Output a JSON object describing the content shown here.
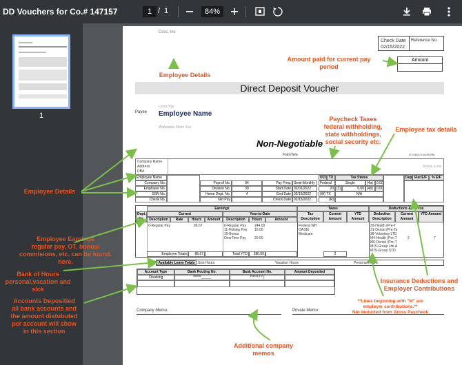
{
  "viewer": {
    "title": "DD Vouchers for Co.# 147157",
    "current_page": "1",
    "page_sep": "/",
    "total_pages": "1",
    "zoom": "84%",
    "thumb_number": "1"
  },
  "voucher": {
    "company_blur": "Cccc, Inc",
    "check_date_label": "Check Date",
    "check_date": "02/15/2022",
    "reference_label": "Reference No.",
    "amount_label": "Amount",
    "heading": "Direct Deposit Voucher",
    "payee_label": "Payee",
    "payee_blur_top": "Lxxxx Yyy",
    "employee_name": "Employee Name",
    "payee_blur_bottom": "Wwwwww, Nnnn Xxx",
    "non_negotiable": "Non-Negotiable",
    "fold_here": "Fold Here",
    "print_stamp": "2/7/2022 5:16:00 PM",
    "company_blur_right": "Xxxxx, x xxx",
    "info_left": [
      [
        "Company Name",
        ""
      ],
      [
        "Address",
        ""
      ],
      [
        "DBA",
        ""
      ]
    ],
    "employee_rows": [
      [
        "Employee Name",
        "",
        "",
        "",
        "",
        ""
      ],
      [
        "Company No.",
        "",
        "Payroll No.",
        "94",
        "Pay Freq.",
        "Semi-Monthly"
      ],
      [
        "Employee No.",
        "",
        "Division No.",
        "39",
        "Start Date",
        "02/01/2022"
      ],
      [
        "SSN No.",
        "",
        "Home Dept. No.",
        "4",
        "End Date",
        "02/15/2022"
      ],
      [
        "Check No.",
        "",
        "Net Pay",
        "",
        "Check Date",
        "02/15/2022"
      ]
    ],
    "tax_header": [
      "UCI",
      "TX",
      "Tax Status"
    ],
    "tax_rows": [
      [
        "Federal",
        "Single",
        "(4a)",
        "0.00"
      ],
      [
        "20",
        "(3)",
        "0.00",
        "(4b)",
        "0.00"
      ],
      [
        "(W) TX",
        "N/A"
      ],
      [
        "(R)",
        ""
      ]
    ],
    "dep_header": [
      "Dep",
      "Flat E/F",
      "% E/F"
    ],
    "sections": {
      "earnings": "Earnings",
      "taxes": "Taxes",
      "deductions": "Deductions & Memos",
      "current": "Current",
      "ytd": "Year-to-Date"
    },
    "earn_cols": [
      "Dept. No.",
      "Description",
      "Rate",
      "Hours",
      "Amount",
      "Description",
      "Hours",
      "Amount",
      "Tax Description",
      "Current Amount",
      "YTD Amount",
      "Deduction Description",
      "Current Amount",
      "YTD Amount"
    ],
    "earn_rows": {
      "dept": "4",
      "desc": "0-Regular Pay",
      "hours": "86.67",
      "ytd_desc": [
        "0-Regular Pay",
        "11-Holiday Pay",
        "19-Bonus",
        "OverTime Pay"
      ],
      "ytd_hours": [
        "244.00",
        "16.00",
        "",
        "20.00"
      ],
      "tax_desc": [
        "Federal WH",
        "OASDI",
        "Medicare"
      ],
      "ded_desc": [
        "29-Health (Pre-T",
        "31-Dental (Pre-Ta",
        "38-Voluntary LTD",
        "M4-Health (Pre-T",
        "M6-Dental (Pre-T",
        "M15-Group Life A",
        "M75-Group STD"
      ],
      "ded_cur": [
        "2"
      ],
      "ded_ytd": [
        "7"
      ]
    },
    "totals": {
      "emp_totals_label": "Employee Totals",
      "emp_hours": "86.67",
      "ytd_label": "Total YTD",
      "ytd_hours": "280.00",
      "tax_cur": "2"
    },
    "leave": {
      "available_label": "Available Leave Totals",
      "sick": "Sick Hours",
      "vacation": "Vacation Hours",
      "personal": "Personal Hours"
    },
    "accounts": {
      "cols": [
        "Account Type",
        "Bank Routing No.",
        "Bank Account No.",
        "Amount Deposited"
      ],
      "row": [
        "Checking",
        "******_____",
        "******:* * |",
        ""
      ]
    },
    "company_memo": "Company Memo:",
    "private_memo": "Private Memo:"
  },
  "annotations": {
    "employee_details_top": "Employee Details",
    "amount_paid": "Amount paid for current pay period",
    "paycheck_taxes": "Paycheck Taxes\nfederal withholding,\nstate withholdings,\nsocial security etc.",
    "employee_tax": "Employee tax details",
    "employee_details_left": "Employee Details",
    "employee_earnings": "Employee Earnings\nregular pay, OT, bonus/\ncommisions, etc. can be found.\nhere.",
    "bank_hours": "Bank of Hours\npersonal,vacation and sick",
    "accounts_deposited": "Accounts Depositied\nall bank accounts and\nthe amount distubuted\nper account will show\nin this section",
    "insurance": "Insurance Deductions and\nEmployer Contributions",
    "lines_m": "**Lines beginning with \"M\" are\nemployer contributions.**\nNot deducted from Gross Paycheck",
    "company_memos": "Additional company memos"
  },
  "colors": {
    "annotation": "#e8531f",
    "arrow": "#7cc04b",
    "viewer_bg": "#525659",
    "toolbar": "#323639"
  },
  "icons": [
    "minus-icon",
    "plus-icon",
    "fit-page-icon",
    "rotate-icon",
    "download-icon",
    "print-icon",
    "more-vert-icon"
  ]
}
